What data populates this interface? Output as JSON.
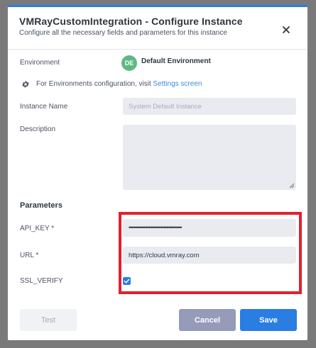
{
  "dialog": {
    "title": "VMRayCustomIntegration - Configure Instance",
    "subtitle": "Configure all the necessary fields and parameters for this instance"
  },
  "environment": {
    "label": "Environment",
    "badge": "DE",
    "name": "Default Environment",
    "info_text": "For Environments configuration, visit ",
    "link_text": "Settings screen"
  },
  "form": {
    "instance_name_label": "Instance Name",
    "instance_name_placeholder": "System Default Instance",
    "description_label": "Description",
    "description_value": ""
  },
  "parameters": {
    "section_title": "Parameters",
    "api_key_label": "API_KEY *",
    "api_key_value": "••••••••••••••••••••••••••••••••",
    "url_label": "URL *",
    "url_value": "https://cloud.vmray.com",
    "ssl_verify_label": "SSL_VERIFY",
    "ssl_verify_checked": true
  },
  "buttons": {
    "test": "Test",
    "cancel": "Cancel",
    "save": "Save"
  },
  "colors": {
    "accent": "#2a7de1",
    "badge": "#5fb882",
    "highlight": "#e0212e",
    "cancel": "#959bb8"
  }
}
